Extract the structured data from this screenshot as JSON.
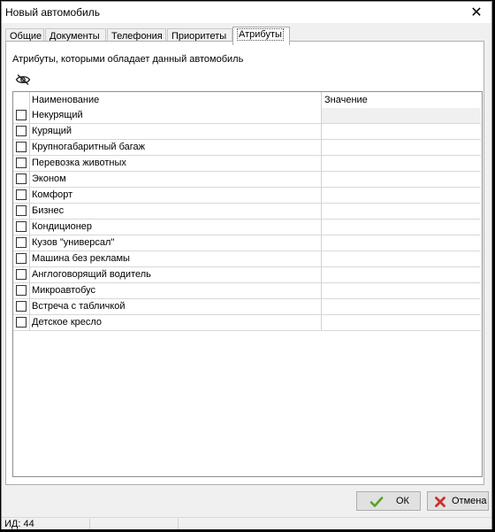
{
  "window": {
    "title": "Новый автомобиль",
    "close_glyph": "✕"
  },
  "tabs": [
    {
      "label": "Общие",
      "active": false
    },
    {
      "label": "Документы",
      "active": false
    },
    {
      "label": "Телефония",
      "active": false
    },
    {
      "label": "Приоритеты",
      "active": false
    },
    {
      "label": "Атрибуты",
      "active": true
    }
  ],
  "panel": {
    "description": "Атрибуты, которыми обладает данный автомобиль",
    "toggle_icon": "eye-slash-icon"
  },
  "grid": {
    "columns": [
      "Наименование",
      "Значение"
    ],
    "rows": [
      {
        "name": "Некурящий",
        "value": "",
        "checked": false
      },
      {
        "name": "Курящий",
        "value": "",
        "checked": false
      },
      {
        "name": "Крупногабаритный багаж",
        "value": "",
        "checked": false
      },
      {
        "name": "Перевозка животных",
        "value": "",
        "checked": false
      },
      {
        "name": "Эконом",
        "value": "",
        "checked": false
      },
      {
        "name": "Комфорт",
        "value": "",
        "checked": false
      },
      {
        "name": "Бизнес",
        "value": "",
        "checked": false
      },
      {
        "name": "Кондиционер",
        "value": "",
        "checked": false
      },
      {
        "name": "Кузов \"универсал\"",
        "value": "",
        "checked": false
      },
      {
        "name": "Машина без рекламы",
        "value": "",
        "checked": false
      },
      {
        "name": "Англоговорящий водитель",
        "value": "",
        "checked": false
      },
      {
        "name": "Микроавтобус",
        "value": "",
        "checked": false
      },
      {
        "name": "Встреча с табличкой",
        "value": "",
        "checked": false
      },
      {
        "name": "Детское кресло",
        "value": "",
        "checked": false
      }
    ]
  },
  "buttons": {
    "ok": {
      "label": "ОК",
      "icon": "checkmark-icon",
      "color": "#5aa02c"
    },
    "cancel": {
      "label": "Отмена",
      "icon": "cross-icon",
      "color": "#c8322a"
    }
  },
  "status": {
    "id_text": "ИД: 44"
  }
}
